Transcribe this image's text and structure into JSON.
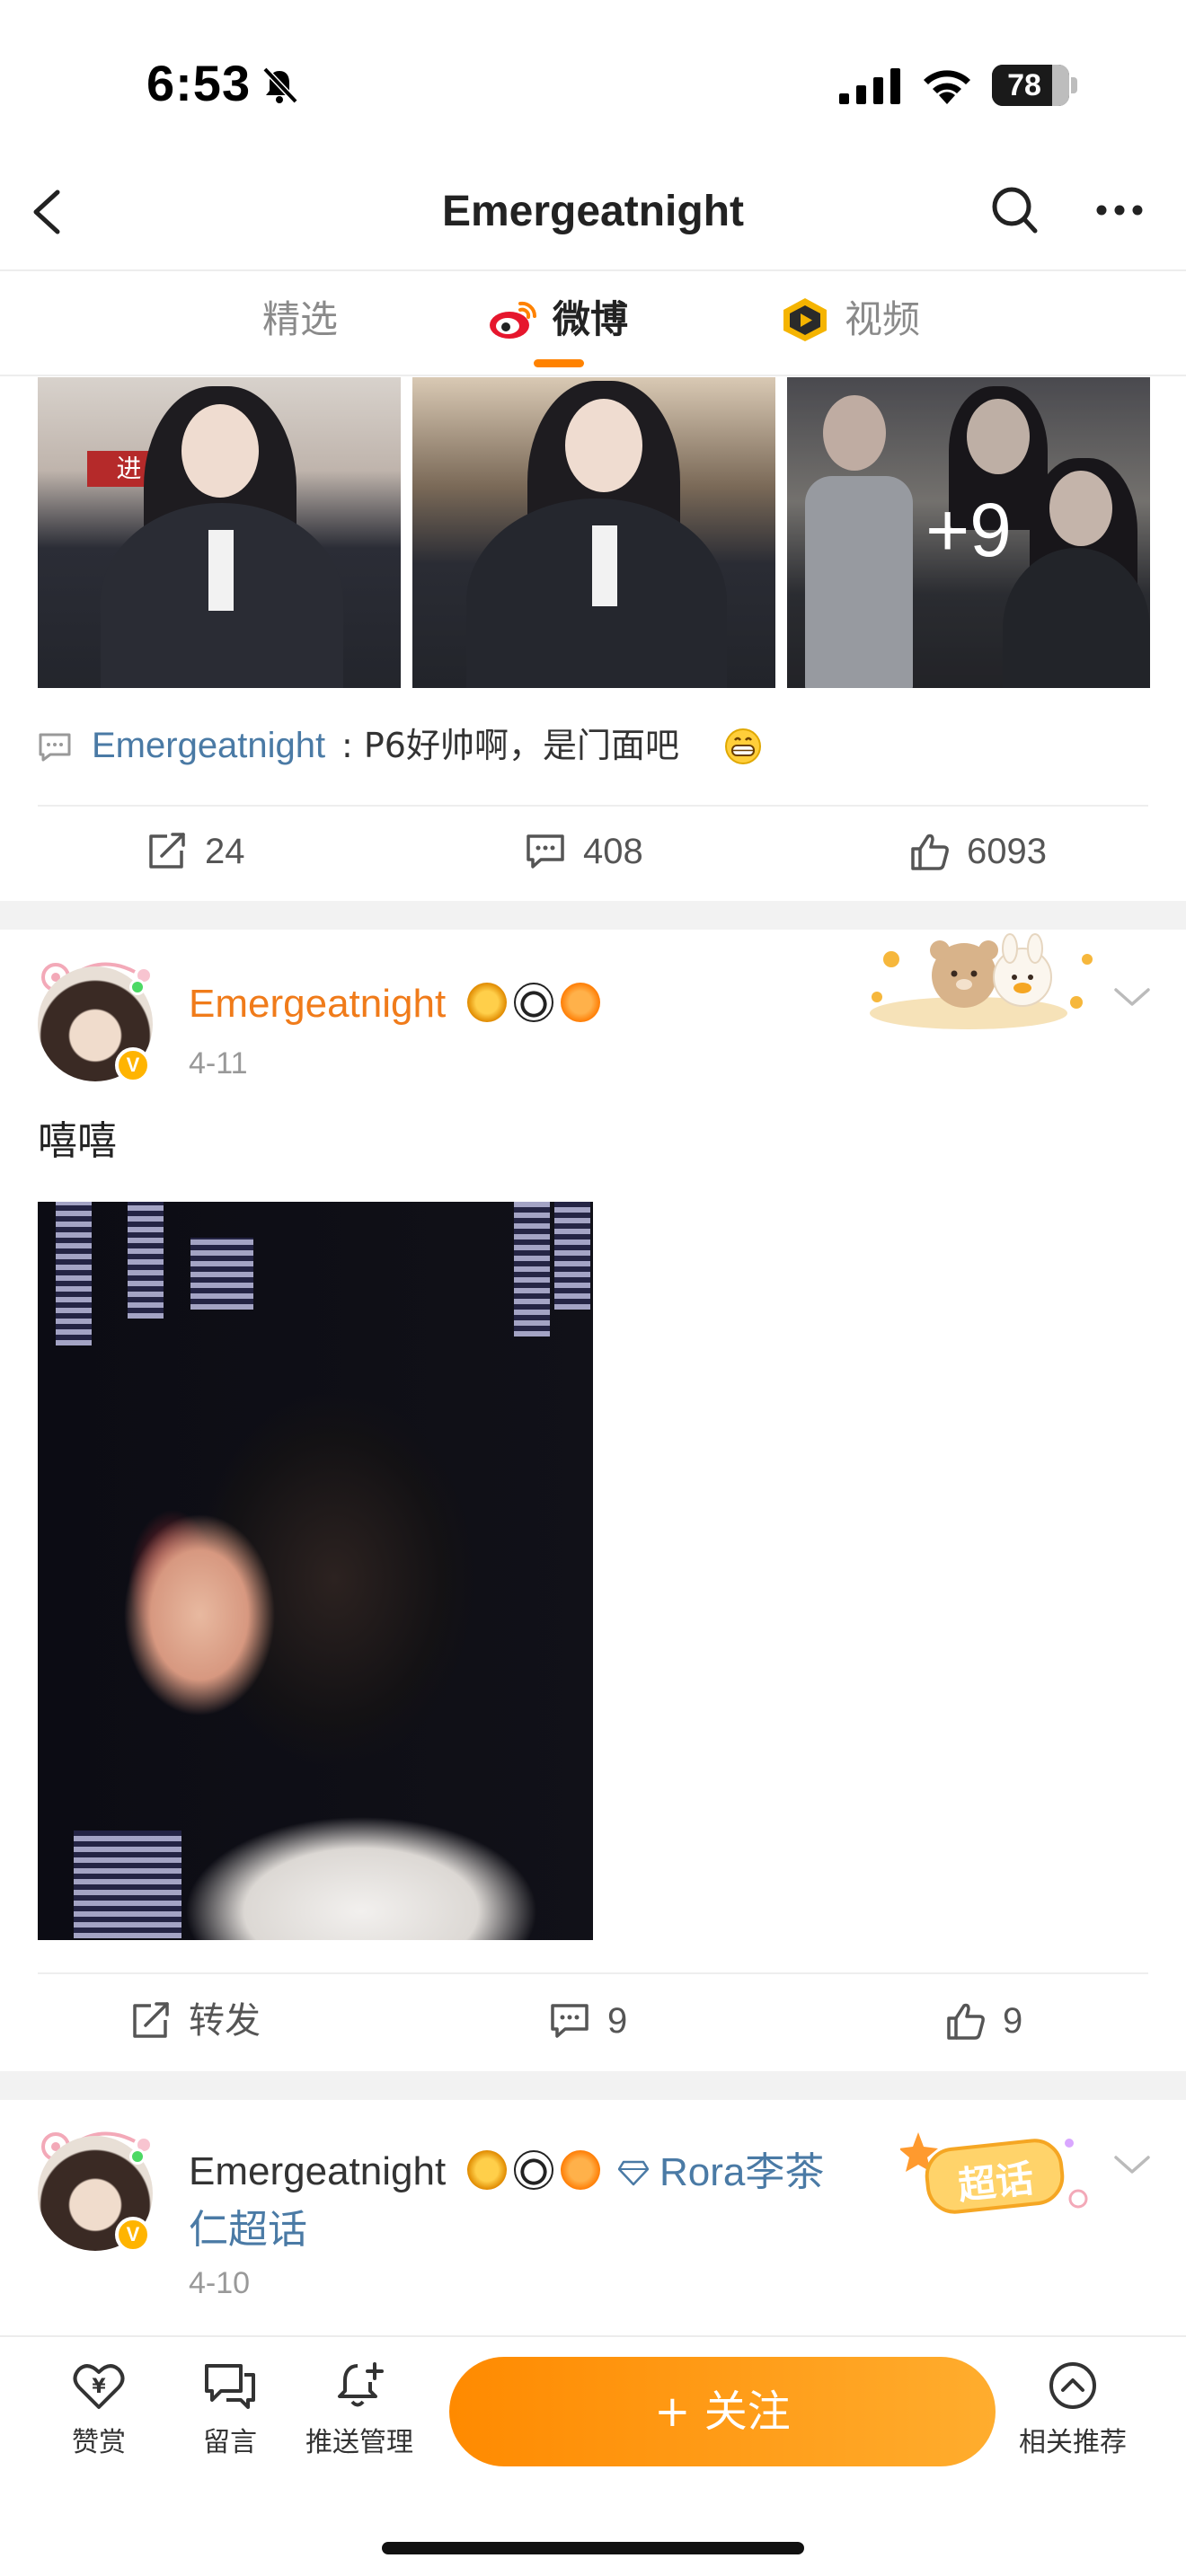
{
  "status_bar": {
    "time": "6:53",
    "battery_level": "78",
    "battery_fraction": 0.78
  },
  "nav": {
    "title": "Emergeatnight"
  },
  "tabs": [
    {
      "label": "精选"
    },
    {
      "label": "微博"
    },
    {
      "label": "视频"
    }
  ],
  "post1": {
    "photo_sign": "进 止",
    "more_photos": "+9",
    "comment": {
      "author": "Emergeatnight",
      "text": ": P6好帅啊，是门面吧"
    },
    "actions": {
      "repost": "24",
      "comments": "408",
      "likes": "6093"
    }
  },
  "post2": {
    "author": "Emergeatnight",
    "date": "4-11",
    "text": "嘻嘻",
    "actions": {
      "repost": "转发",
      "comments": "9",
      "likes": "9"
    }
  },
  "post3": {
    "author": "Emergeatnight",
    "topic_line1": "Rora李茶",
    "topic_line2": "仁超话",
    "date": "4-10",
    "sticker_text": "超话"
  },
  "bottom_bar": {
    "reward": "赞赏",
    "message": "留言",
    "push_manage": "推送管理",
    "follow": "+ 关注",
    "related": "相关推荐"
  },
  "colors": {
    "accent_orange": "#ff8200",
    "link_blue": "#4a7aa5",
    "author_orange": "#f07b1a"
  }
}
